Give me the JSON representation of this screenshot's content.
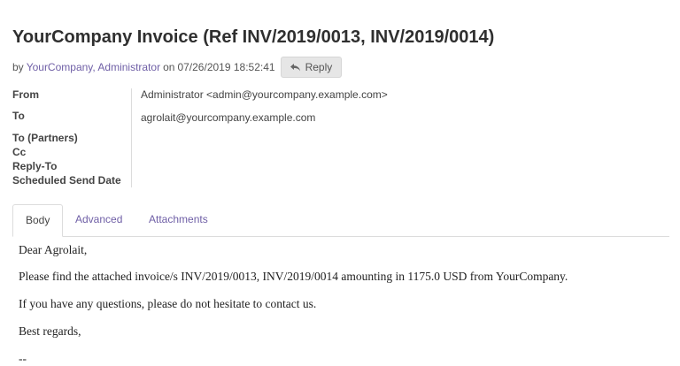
{
  "header": {
    "title": "YourCompany Invoice (Ref INV/2019/0013, INV/2019/0014)",
    "by_label": "by",
    "author": "YourCompany, Administrator",
    "on_label": "on",
    "date": "07/26/2019 18:52:41",
    "reply_label": "Reply",
    "reply_icon": "reply-arrow-icon"
  },
  "meta": {
    "from_label": "From",
    "from_value": "Administrator <admin@yourcompany.example.com>",
    "to_label": "To",
    "to_value": "agrolait@yourcompany.example.com",
    "to_partners_label": "To (Partners)",
    "cc_label": "Cc",
    "reply_to_label": "Reply-To",
    "scheduled_label": "Scheduled Send Date"
  },
  "tabs": [
    {
      "label": "Body",
      "active": true
    },
    {
      "label": "Advanced",
      "active": false
    },
    {
      "label": "Attachments",
      "active": false
    }
  ],
  "body": {
    "greeting": "Dear Agrolait,",
    "line1": "Please find the attached invoice/s INV/2019/0013, INV/2019/0014 amounting in 1175.0 USD from YourCompany.",
    "line2": "If you have any questions, please do not hesitate to contact us.",
    "closing": "Best regards,",
    "signature": "--"
  },
  "colors": {
    "accent": "#6f5fa6",
    "border": "#dcdcdc",
    "button_bg": "#e6e6e6"
  }
}
